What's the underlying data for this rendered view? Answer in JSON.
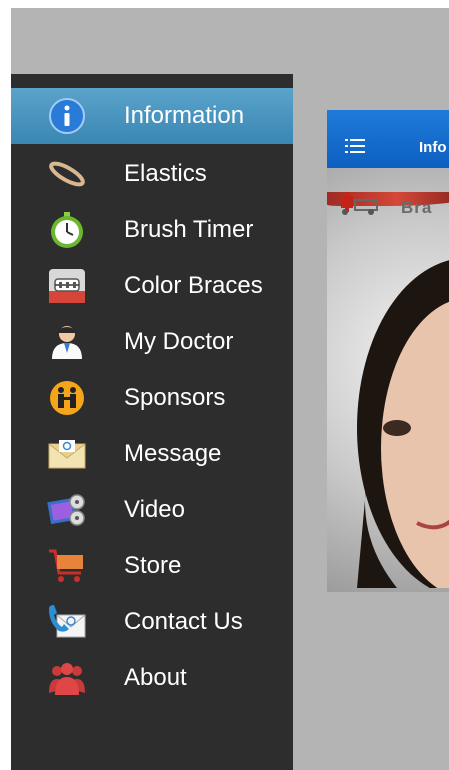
{
  "main": {
    "header_title": "Info",
    "banner_text": "Bra"
  },
  "menu": {
    "items": [
      {
        "label": "Information",
        "icon": "info-icon",
        "active": true
      },
      {
        "label": "Elastics",
        "icon": "elastic-band-icon",
        "active": false
      },
      {
        "label": "Brush Timer",
        "icon": "stopwatch-icon",
        "active": false
      },
      {
        "label": "Color Braces",
        "icon": "braces-icon",
        "active": false
      },
      {
        "label": "My Doctor",
        "icon": "doctor-icon",
        "active": false
      },
      {
        "label": "Sponsors",
        "icon": "sponsors-icon",
        "active": false
      },
      {
        "label": "Message",
        "icon": "envelope-icon",
        "active": false
      },
      {
        "label": "Video",
        "icon": "video-icon",
        "active": false
      },
      {
        "label": "Store",
        "icon": "shopping-cart-icon",
        "active": false
      },
      {
        "label": "Contact Us",
        "icon": "contact-icon",
        "active": false
      },
      {
        "label": "About",
        "icon": "people-icon",
        "active": false
      }
    ]
  },
  "colors": {
    "menu_bg": "#2d2d2d",
    "active_bg": "#4694c0",
    "header_bg": "#1565c8",
    "overlay": "#b4b4b4"
  }
}
